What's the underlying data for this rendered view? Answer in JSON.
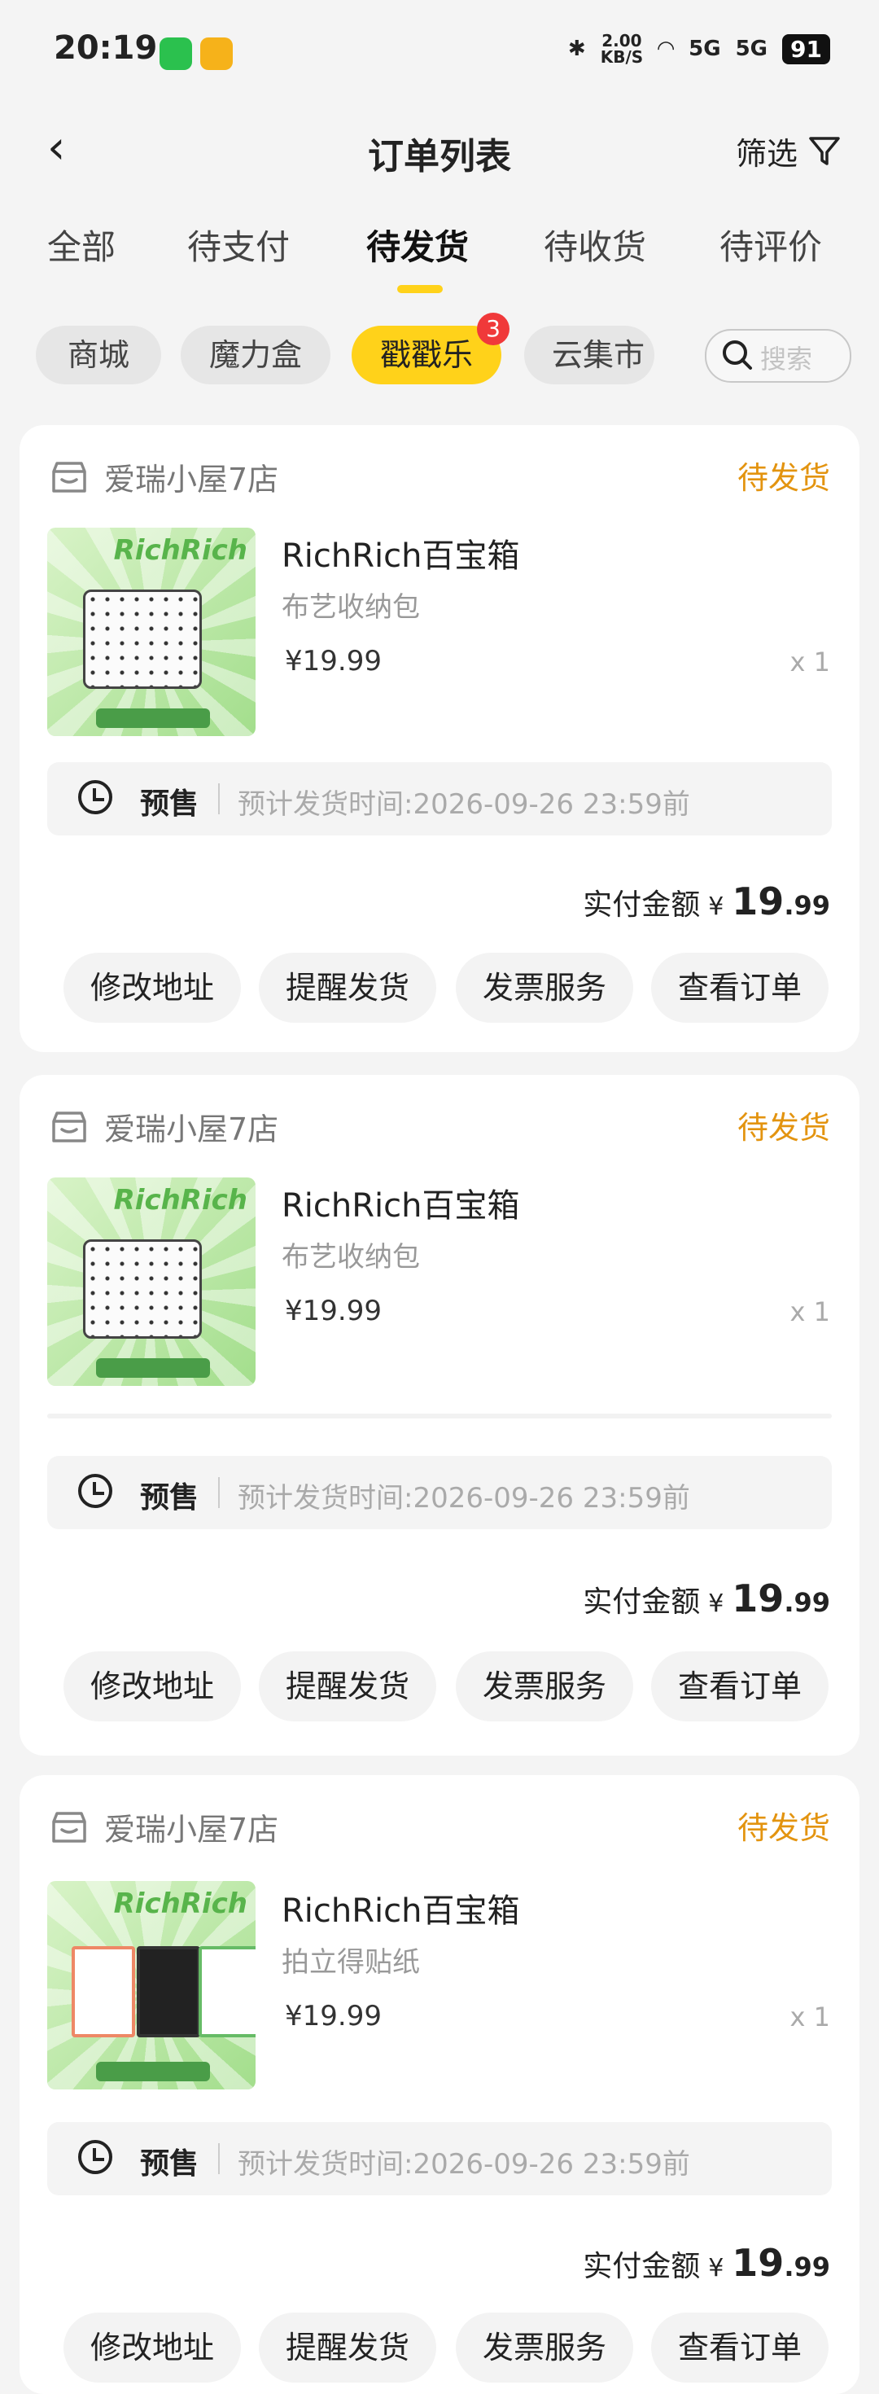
{
  "status_bar": {
    "time": "20:19",
    "network_speed": "2.00\nKB/S",
    "signal1": "5G",
    "signal2": "5G",
    "battery": "91"
  },
  "header": {
    "title": "订单列表",
    "filter_label": "筛选"
  },
  "tabs": [
    {
      "label": "全部"
    },
    {
      "label": "待支付"
    },
    {
      "label": "待发货",
      "active": true
    },
    {
      "label": "待收货"
    },
    {
      "label": "待评价"
    }
  ],
  "chips": [
    {
      "label": "商城"
    },
    {
      "label": "魔力盒"
    },
    {
      "label": "戳戳乐",
      "badge": "3",
      "active": true
    },
    {
      "label": "云集市"
    }
  ],
  "search": {
    "placeholder": "搜索"
  },
  "orders": [
    {
      "shop": "爱瑞小屋7店",
      "state": "待发货",
      "name": "RichRich百宝箱",
      "spec": "布艺收纳包",
      "price": "¥19.99",
      "qty": "x 1",
      "presale": "预售",
      "eta": "预计发货时间:2026-09-26 23:59前",
      "paid_label": "实付金额",
      "currency": "¥",
      "paid_int": "19",
      "paid_dec": ".99",
      "actions": [
        "修改地址",
        "提醒发货",
        "发票服务",
        "查看订单"
      ],
      "thumb_logo": "RichRich"
    },
    {
      "shop": "爱瑞小屋7店",
      "state": "待发货",
      "name": "RichRich百宝箱",
      "spec": "布艺收纳包",
      "price": "¥19.99",
      "qty": "x 1",
      "presale": "预售",
      "eta": "预计发货时间:2026-09-26 23:59前",
      "paid_label": "实付金额",
      "currency": "¥",
      "paid_int": "19",
      "paid_dec": ".99",
      "actions": [
        "修改地址",
        "提醒发货",
        "发票服务",
        "查看订单"
      ],
      "thumb_logo": "RichRich"
    },
    {
      "shop": "爱瑞小屋7店",
      "state": "待发货",
      "name": "RichRich百宝箱",
      "spec": "拍立得贴纸",
      "price": "¥19.99",
      "qty": "x 1",
      "presale": "预售",
      "eta": "预计发货时间:2026-09-26 23:59前",
      "paid_label": "实付金额",
      "currency": "¥",
      "paid_int": "19",
      "paid_dec": ".99",
      "actions": [
        "修改地址",
        "提醒发货",
        "发票服务",
        "查看订单"
      ],
      "thumb_logo": "RichRich"
    }
  ],
  "colors": {
    "accent": "#ffd21a",
    "state": "#e39410",
    "badge": "#f0393a"
  }
}
